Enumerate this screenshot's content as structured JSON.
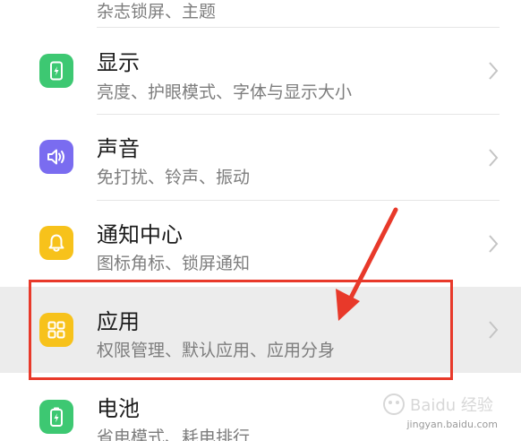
{
  "settings_list": {
    "items": [
      {
        "key": "top_partial",
        "title": "",
        "subtitle": "杂志锁屏、主题",
        "icon": "theme-icon"
      },
      {
        "key": "display",
        "title": "显示",
        "subtitle": "亮度、护眼模式、字体与显示大小",
        "icon": "display-brightness-icon"
      },
      {
        "key": "sound",
        "title": "声音",
        "subtitle": "免打扰、铃声、振动",
        "icon": "speaker-icon"
      },
      {
        "key": "notification",
        "title": "通知中心",
        "subtitle": "图标角标、锁屏通知",
        "icon": "bell-icon"
      },
      {
        "key": "apps",
        "title": "应用",
        "subtitle": "权限管理、默认应用、应用分身",
        "icon": "apps-grid-icon"
      },
      {
        "key": "battery",
        "title": "电池",
        "subtitle": "省电模式、耗电排行",
        "icon": "battery-icon"
      }
    ]
  },
  "colors": {
    "icon_green": "#3dc872",
    "icon_purple": "#7a6cf0",
    "icon_yellow": "#f7c21b",
    "annotation_red": "#e8392a",
    "title_text": "#1c1c1c",
    "subtitle_text": "#7d7d7d"
  },
  "watermark": {
    "brand": "Baidu 经验",
    "url": "jingyan.baidu.com"
  }
}
